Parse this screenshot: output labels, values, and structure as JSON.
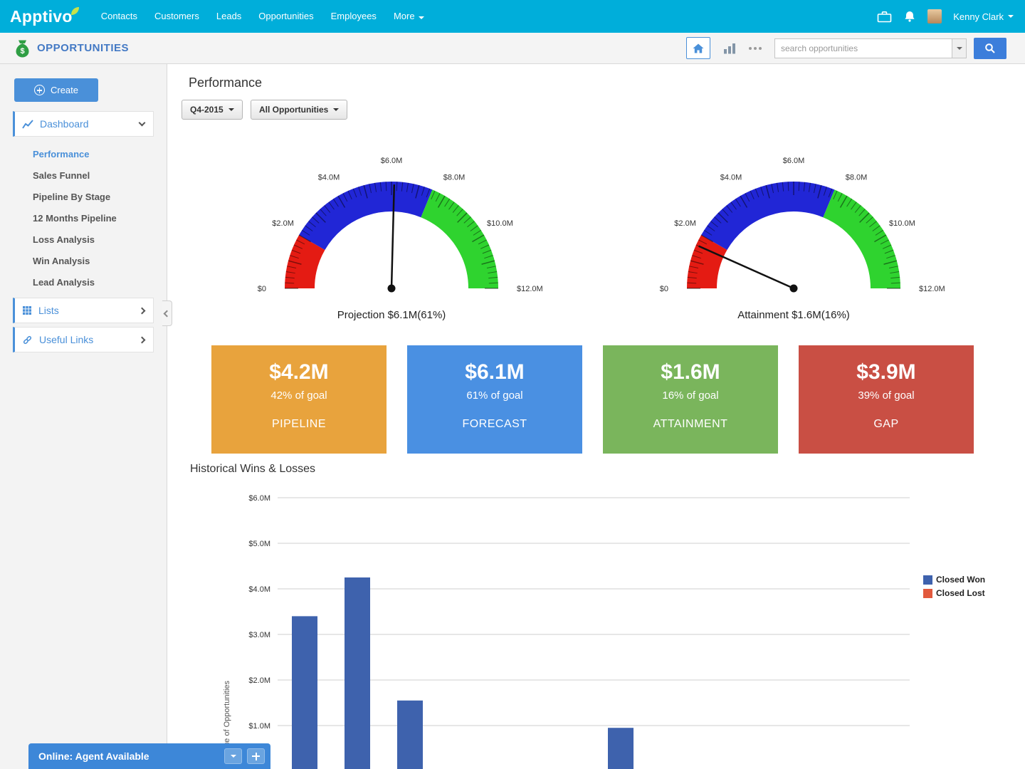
{
  "topnav": {
    "brand": "Apptivo",
    "items": [
      {
        "label": "Contacts"
      },
      {
        "label": "Customers"
      },
      {
        "label": "Leads"
      },
      {
        "label": "Opportunities"
      },
      {
        "label": "Employees"
      },
      {
        "label": "More",
        "has_caret": true
      }
    ],
    "user": "Kenny Clark"
  },
  "appbar": {
    "title": "OPPORTUNITIES",
    "search_placeholder": "search opportunities"
  },
  "sidebar": {
    "create_label": "Create",
    "dashboard_label": "Dashboard",
    "dashboard_items": [
      "Performance",
      "Sales Funnel",
      "Pipeline By Stage",
      "12 Months Pipeline",
      "Loss Analysis",
      "Win Analysis",
      "Lead Analysis"
    ],
    "active_item": "Performance",
    "lists_label": "Lists",
    "useful_links_label": "Useful Links"
  },
  "main": {
    "section_title": "Performance",
    "filters": {
      "period": "Q4-2015",
      "scope": "All Opportunities"
    },
    "kpis": [
      {
        "value": "$4.2M",
        "subtitle": "42% of goal",
        "label": "PIPELINE",
        "color": "#e8a33d"
      },
      {
        "value": "$6.1M",
        "subtitle": "61% of goal",
        "label": "FORECAST",
        "color": "#4a90e2"
      },
      {
        "value": "$1.6M",
        "subtitle": "16% of goal",
        "label": "ATTAINMENT",
        "color": "#7ab55c"
      },
      {
        "value": "$3.9M",
        "subtitle": "39% of goal",
        "label": "GAP",
        "color": "#c94f44"
      }
    ],
    "history_title": "Historical Wins & Losses"
  },
  "chat": {
    "status": "Online: Agent Available"
  },
  "chart_data": [
    {
      "type": "gauge",
      "caption": "Projection $6.1M(61%)",
      "value": 6.1,
      "max": 12,
      "tick_labels": [
        "$0",
        "$2.0M",
        "$4.0M",
        "$6.0M",
        "$8.0M",
        "$10.0M",
        "$12.0M"
      ],
      "segments": [
        {
          "from": 0,
          "to": 2,
          "color": "#e41b13"
        },
        {
          "from": 2,
          "to": 7.5,
          "color": "#2126d6"
        },
        {
          "from": 7.5,
          "to": 12,
          "color": "#2fd32f"
        }
      ]
    },
    {
      "type": "gauge",
      "caption": "Attainment $1.6M(16%)",
      "value": 1.6,
      "max": 12,
      "tick_labels": [
        "$0",
        "$2.0M",
        "$4.0M",
        "$6.0M",
        "$8.0M",
        "$10.0M",
        "$12.0M"
      ],
      "segments": [
        {
          "from": 0,
          "to": 2,
          "color": "#e41b13"
        },
        {
          "from": 2,
          "to": 7.5,
          "color": "#2126d6"
        },
        {
          "from": 7.5,
          "to": 12,
          "color": "#2fd32f"
        }
      ]
    },
    {
      "type": "bar",
      "title": "Historical Wins & Losses",
      "ylabel": "Value of Opportunities",
      "ylim": [
        0,
        6
      ],
      "yticks": [
        {
          "value": 1,
          "label": "$1.0M"
        },
        {
          "value": 2,
          "label": "$2.0M"
        },
        {
          "value": 3,
          "label": "$3.0M"
        },
        {
          "value": 4,
          "label": "$4.0M"
        },
        {
          "value": 5,
          "label": "$5.0M"
        },
        {
          "value": 6,
          "label": "$6.0M"
        }
      ],
      "grid": true,
      "legend_position": "right",
      "series": [
        {
          "name": "Closed Won",
          "color": "#3e62ad",
          "points": [
            {
              "slot": 0,
              "value": 3.4
            },
            {
              "slot": 1,
              "value": 4.25
            },
            {
              "slot": 2,
              "value": 1.55
            },
            {
              "slot": 6,
              "value": 0.95
            }
          ]
        },
        {
          "name": "Closed Lost",
          "color": "#e2593d",
          "points": []
        }
      ]
    }
  ]
}
